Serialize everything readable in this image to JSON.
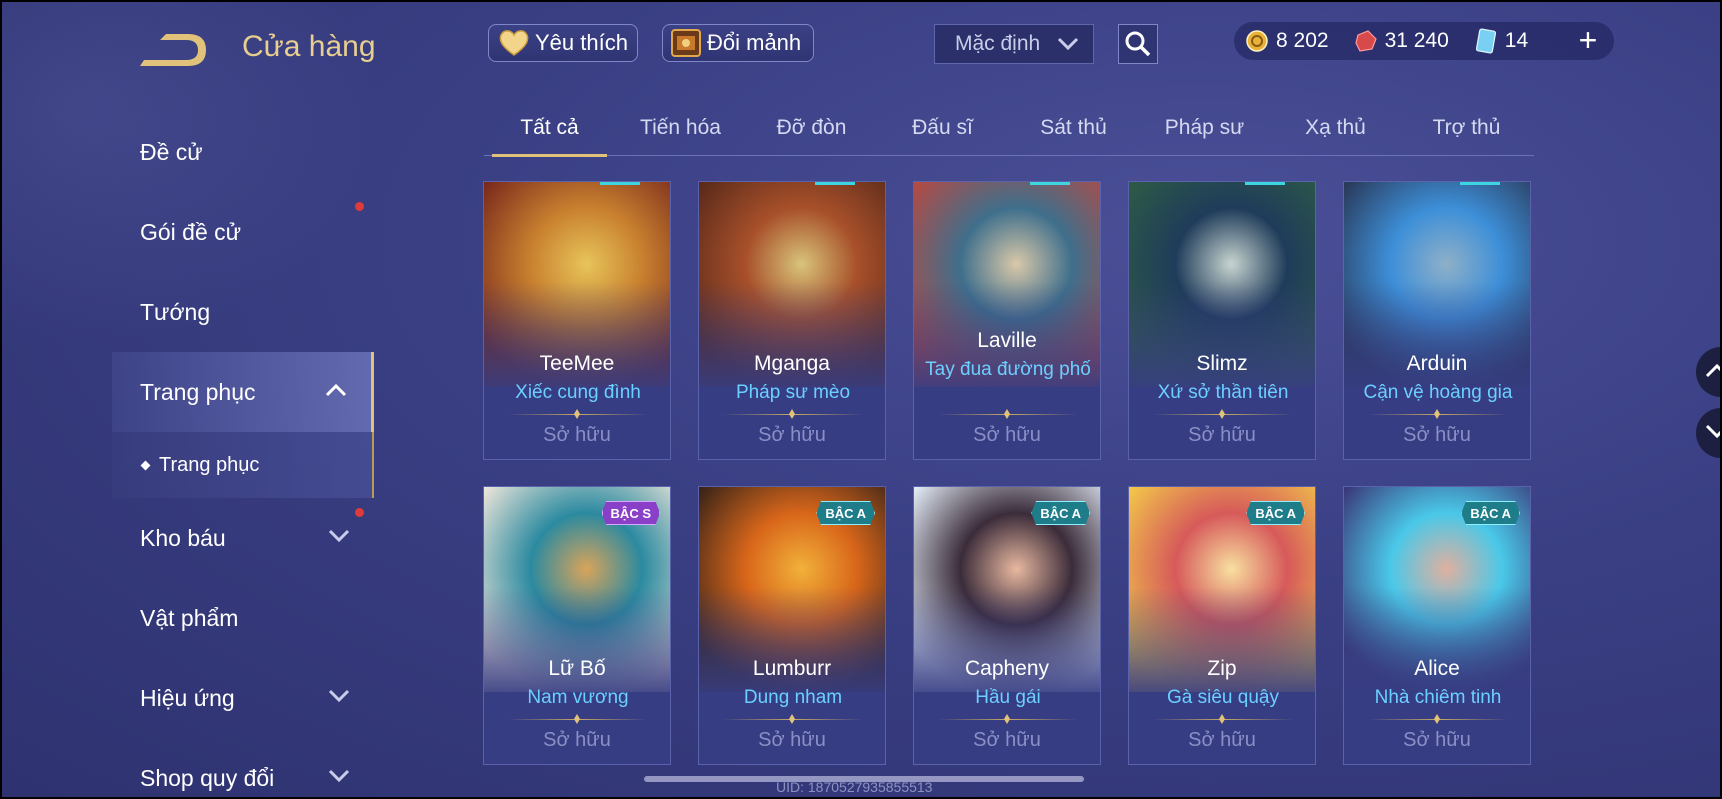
{
  "header": {
    "title": "Cửa hàng",
    "favorite_label": "Yêu thích",
    "exchange_label": "Đổi mảnh",
    "sort_value": "Mặc định",
    "currencies": [
      {
        "icon": "gold-coin-icon",
        "value": "8 202"
      },
      {
        "icon": "voucher-gem-icon",
        "value": "31 240"
      },
      {
        "icon": "card-icon",
        "value": "14"
      }
    ]
  },
  "sidebar": {
    "items": [
      {
        "label": "Đề cử"
      },
      {
        "label": "Gói đề cử"
      },
      {
        "label": "Tướng"
      },
      {
        "label": "Trang phục"
      },
      {
        "label": "Kho báu"
      },
      {
        "label": "Vật phẩm"
      },
      {
        "label": "Hiệu ứng"
      },
      {
        "label": "Shop quy đổi"
      }
    ],
    "sub_item": "Trang phục"
  },
  "tabs": [
    "Tất cả",
    "Tiến hóa",
    "Đỡ đòn",
    "Đấu sĩ",
    "Sát thủ",
    "Pháp sư",
    "Xạ thủ",
    "Trợ thủ"
  ],
  "owned_label": "Sở hữu",
  "cards": [
    {
      "hero": "TeeMee",
      "skin": "Xiếc cung đình",
      "rank": "",
      "colors": [
        "#7a2a1c",
        "#c9812f",
        "#e7c45a"
      ]
    },
    {
      "hero": "Mganga",
      "skin": "Pháp sư mèo",
      "rank": "",
      "colors": [
        "#5a2a1a",
        "#a8502a",
        "#d8c47a"
      ]
    },
    {
      "hero": "Laville",
      "skin": "Tay đua đường phố",
      "rank": "",
      "colors": [
        "#b34a44",
        "#3f6f8c",
        "#d9c8a8"
      ]
    },
    {
      "hero": "Slimz",
      "skin": "Xứ sở thần tiên",
      "rank": "",
      "colors": [
        "#2d5a46",
        "#1f3c5a",
        "#c8d4d0"
      ]
    },
    {
      "hero": "Arduin",
      "skin": "Cận vệ hoàng gia",
      "rank": "",
      "colors": [
        "#2a3a5a",
        "#3d8fd8",
        "#8fb0c8"
      ]
    },
    {
      "hero": "Lữ Bố",
      "skin": "Nam vương",
      "rank": "BẬC S",
      "colors": [
        "#e8e3d8",
        "#2b8aa0",
        "#d9a45a"
      ]
    },
    {
      "hero": "Lumburr",
      "skin": "Dung nham",
      "rank": "BẬC A",
      "colors": [
        "#3a2418",
        "#d8661a",
        "#f2b13a"
      ]
    },
    {
      "hero": "Capheny",
      "skin": "Hầu gái",
      "rank": "BẬC A",
      "colors": [
        "#dfe8f2",
        "#3b2c3a",
        "#e8b8a0"
      ]
    },
    {
      "hero": "Zip",
      "skin": "Gà siêu quậy",
      "rank": "BẬC A",
      "colors": [
        "#f2c64a",
        "#d65a5a",
        "#f8e0a0"
      ]
    },
    {
      "hero": "Alice",
      "skin": "Nhà chiêm tinh",
      "rank": "BẬC A",
      "colors": [
        "#3a3a7a",
        "#4ac8e8",
        "#e0b0a0"
      ]
    }
  ],
  "uid_text": "UID: 1870527935855513"
}
